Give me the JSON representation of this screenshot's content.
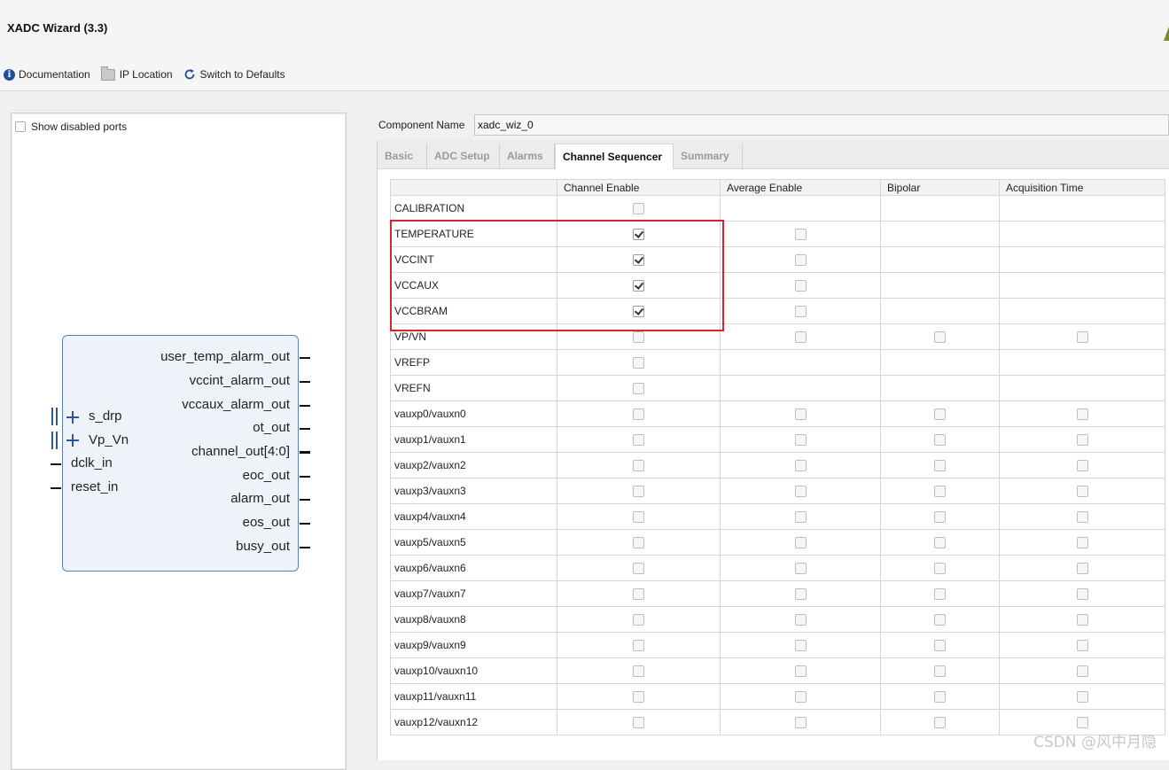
{
  "window": {
    "title": "XADC Wizard (3.3)"
  },
  "toolbar": {
    "documentation_label": "Documentation",
    "ip_location_label": "IP Location",
    "switch_defaults_label": "Switch to Defaults",
    "icons": [
      "info-icon",
      "folder-icon",
      "refresh-icon"
    ]
  },
  "left_panel": {
    "show_disabled_label": "Show disabled ports",
    "show_disabled_checked": false,
    "block": {
      "left_ports": [
        {
          "name": "s_drp",
          "type": "bus"
        },
        {
          "name": "Vp_Vn",
          "type": "bus"
        },
        {
          "name": "dclk_in",
          "type": "wire"
        },
        {
          "name": "reset_in",
          "type": "wire"
        }
      ],
      "right_ports": [
        {
          "name": "user_temp_alarm_out",
          "type": "wire"
        },
        {
          "name": "vccint_alarm_out",
          "type": "wire"
        },
        {
          "name": "vccaux_alarm_out",
          "type": "wire"
        },
        {
          "name": "ot_out",
          "type": "wire"
        },
        {
          "name": "channel_out[4:0]",
          "type": "bus"
        },
        {
          "name": "eoc_out",
          "type": "wire"
        },
        {
          "name": "alarm_out",
          "type": "wire"
        },
        {
          "name": "eos_out",
          "type": "wire"
        },
        {
          "name": "busy_out",
          "type": "wire"
        }
      ]
    }
  },
  "component": {
    "label": "Component Name",
    "value": "xadc_wiz_0"
  },
  "tabs": [
    {
      "label": "Basic",
      "active": false
    },
    {
      "label": "ADC Setup",
      "active": false
    },
    {
      "label": "Alarms",
      "active": false
    },
    {
      "label": "Channel Sequencer",
      "active": true
    },
    {
      "label": "Summary",
      "active": false
    }
  ],
  "table": {
    "headers": [
      "",
      "Channel Enable",
      "Average Enable",
      "Bipolar",
      "Acquisition Time"
    ],
    "rows": [
      {
        "name": "CALIBRATION",
        "channel": false,
        "average": null,
        "bipolar": null,
        "acq": null
      },
      {
        "name": "TEMPERATURE",
        "channel": true,
        "average": false,
        "bipolar": null,
        "acq": null
      },
      {
        "name": "VCCINT",
        "channel": true,
        "average": false,
        "bipolar": null,
        "acq": null
      },
      {
        "name": "VCCAUX",
        "channel": true,
        "average": false,
        "bipolar": null,
        "acq": null
      },
      {
        "name": "VCCBRAM",
        "channel": true,
        "average": false,
        "bipolar": null,
        "acq": null
      },
      {
        "name": "VP/VN",
        "channel": false,
        "average": false,
        "bipolar": false,
        "acq": false
      },
      {
        "name": "VREFP",
        "channel": false,
        "average": null,
        "bipolar": null,
        "acq": null
      },
      {
        "name": "VREFN",
        "channel": false,
        "average": null,
        "bipolar": null,
        "acq": null
      },
      {
        "name": "vauxp0/vauxn0",
        "channel": false,
        "average": false,
        "bipolar": false,
        "acq": false
      },
      {
        "name": "vauxp1/vauxn1",
        "channel": false,
        "average": false,
        "bipolar": false,
        "acq": false
      },
      {
        "name": "vauxp2/vauxn2",
        "channel": false,
        "average": false,
        "bipolar": false,
        "acq": false
      },
      {
        "name": "vauxp3/vauxn3",
        "channel": false,
        "average": false,
        "bipolar": false,
        "acq": false
      },
      {
        "name": "vauxp4/vauxn4",
        "channel": false,
        "average": false,
        "bipolar": false,
        "acq": false
      },
      {
        "name": "vauxp5/vauxn5",
        "channel": false,
        "average": false,
        "bipolar": false,
        "acq": false
      },
      {
        "name": "vauxp6/vauxn6",
        "channel": false,
        "average": false,
        "bipolar": false,
        "acq": false
      },
      {
        "name": "vauxp7/vauxn7",
        "channel": false,
        "average": false,
        "bipolar": false,
        "acq": false
      },
      {
        "name": "vauxp8/vauxn8",
        "channel": false,
        "average": false,
        "bipolar": false,
        "acq": false
      },
      {
        "name": "vauxp9/vauxn9",
        "channel": false,
        "average": false,
        "bipolar": false,
        "acq": false
      },
      {
        "name": "vauxp10/vauxn10",
        "channel": false,
        "average": false,
        "bipolar": false,
        "acq": false
      },
      {
        "name": "vauxp11/vauxn11",
        "channel": false,
        "average": false,
        "bipolar": false,
        "acq": false
      },
      {
        "name": "vauxp12/vauxn12",
        "channel": false,
        "average": false,
        "bipolar": false,
        "acq": false
      }
    ]
  },
  "annotation": {
    "highlight_color": "#d9242b"
  },
  "watermark": "CSDN @风中月隐"
}
